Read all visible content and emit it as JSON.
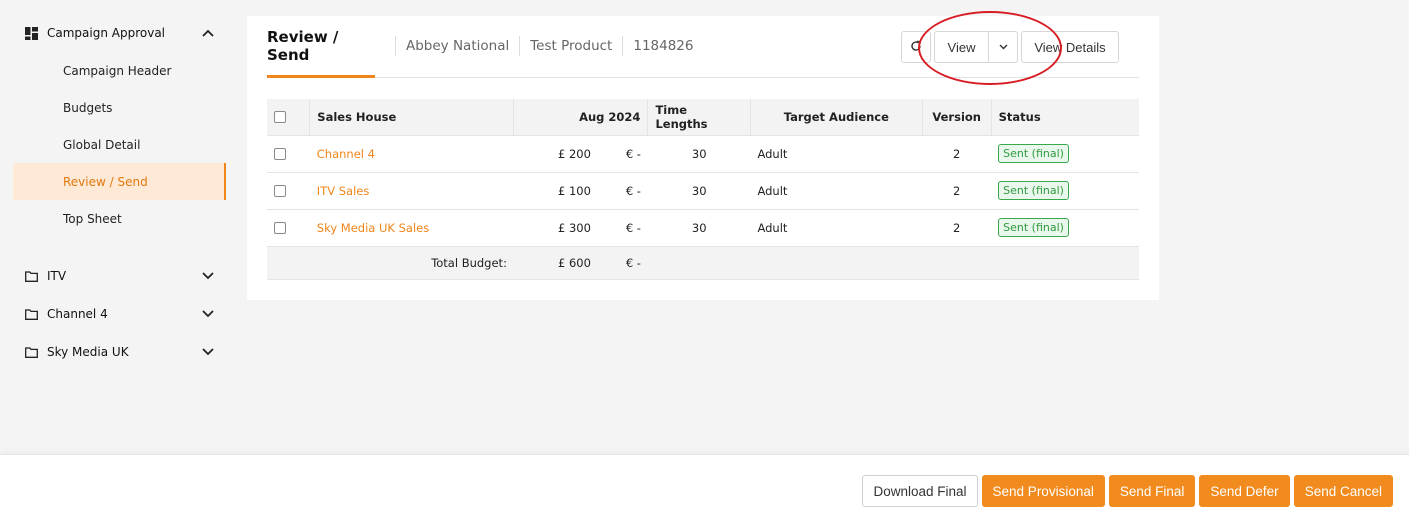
{
  "sidebar": {
    "campaign_group": {
      "label": "Campaign Approval",
      "icon": "dashboard-icon",
      "items": [
        {
          "label": "Campaign Header"
        },
        {
          "label": "Budgets"
        },
        {
          "label": "Global Detail"
        },
        {
          "label": "Review / Send",
          "active": true
        },
        {
          "label": "Top Sheet"
        }
      ]
    },
    "folders": [
      {
        "label": "ITV",
        "icon": "folder-icon"
      },
      {
        "label": "Channel 4",
        "icon": "folder-icon"
      },
      {
        "label": "Sky Media UK",
        "icon": "folder-icon"
      }
    ]
  },
  "header": {
    "active_tab": "Review / Send",
    "breadcrumbs": [
      "Abbey National",
      "Test Product",
      "1184826"
    ],
    "toolbar": {
      "refresh_icon": "refresh-icon",
      "view_label": "View",
      "details_label": "View Details"
    }
  },
  "table": {
    "columns": [
      "Sales House",
      "Aug 2024",
      "Time Lengths",
      "Target Audience",
      "Version",
      "Status"
    ],
    "rows": [
      {
        "sales_house": "Channel 4",
        "gbp": "£ 200",
        "eur": "€ -",
        "time": "30",
        "audience": "Adult",
        "version": "2",
        "status": "Sent (final)"
      },
      {
        "sales_house": "ITV Sales",
        "gbp": "£ 100",
        "eur": "€ -",
        "time": "30",
        "audience": "Adult",
        "version": "2",
        "status": "Sent (final)"
      },
      {
        "sales_house": "Sky Media UK Sales",
        "gbp": "£ 300",
        "eur": "€ -",
        "time": "30",
        "audience": "Adult",
        "version": "2",
        "status": "Sent (final)"
      }
    ],
    "total": {
      "label": "Total Budget:",
      "gbp": "£ 600",
      "eur": "€ -"
    }
  },
  "footer": {
    "download_final": "Download Final",
    "send_provisional": "Send Provisional",
    "send_final": "Send Final",
    "send_defer": "Send Defer",
    "send_cancel": "Send Cancel"
  },
  "colors": {
    "accent": "#f0851a",
    "status_green": "#39a84a",
    "annotation_red": "#d71d24"
  }
}
